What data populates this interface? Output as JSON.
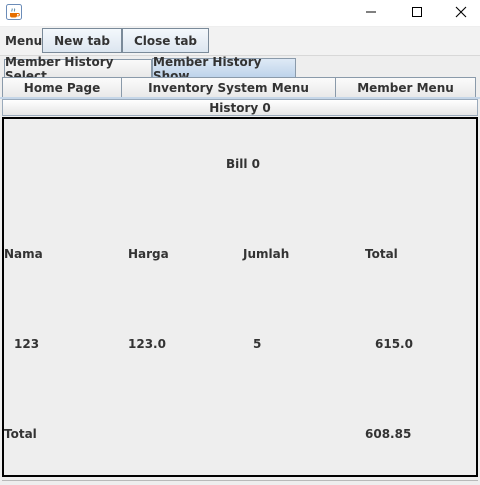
{
  "window": {
    "icon": "java-cup-icon",
    "controls": [
      "minimize-icon",
      "maximize-icon",
      "close-icon"
    ]
  },
  "menubar": {
    "menu_label": "Menu",
    "new_tab_label": "New tab",
    "close_tab_label": "Close tab"
  },
  "tabs_row1": [
    {
      "label": "Member History Select",
      "selected": false
    },
    {
      "label": "Member History Show",
      "selected": true
    }
  ],
  "tabs_row2": [
    {
      "label": "Home Page"
    },
    {
      "label": "Inventory System Menu"
    },
    {
      "label": "Member Menu"
    }
  ],
  "history": {
    "title": "History 0",
    "bill_title": "Bill 0",
    "columns": [
      "Nama",
      "Harga",
      "Jumlah",
      "Total"
    ],
    "rows": [
      {
        "nama": "123",
        "harga": "123.0",
        "jumlah": "5",
        "total": "615.0"
      }
    ],
    "total_label": "Total",
    "total_value": "608.85"
  },
  "colors": {
    "selected_tab": "#bcd2ea",
    "panel_border": "#000000",
    "background": "#eeeeee"
  }
}
